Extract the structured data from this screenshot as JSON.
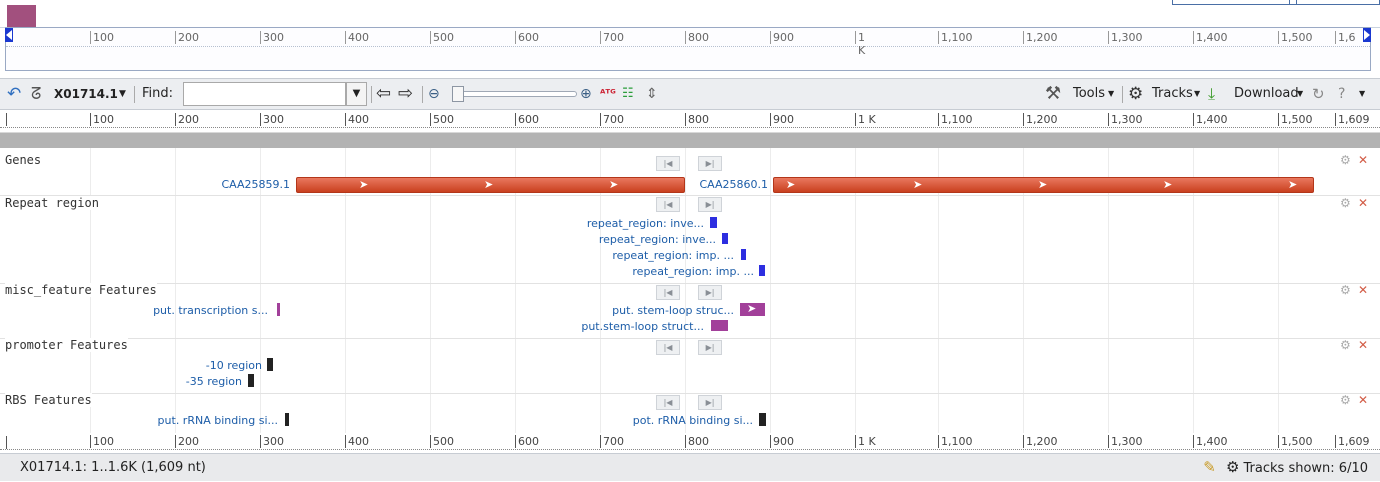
{
  "toolbar": {
    "sequence": "X01714.1",
    "find_label": "Find:",
    "find_value": "",
    "tools": "Tools",
    "tracks": "Tracks",
    "download": "Download"
  },
  "ruler_ticks": [
    "100",
    "200",
    "300",
    "400",
    "500",
    "600",
    "700",
    "800",
    "900",
    "1 K",
    "1,100",
    "1,200",
    "1,300",
    "1,400",
    "1,500",
    "1,609"
  ],
  "overview_ticks": [
    "100",
    "200",
    "300",
    "400",
    "500",
    "600",
    "700",
    "800",
    "900",
    "1 K",
    "1,100",
    "1,200",
    "1,300",
    "1,400",
    "1,500",
    "1,6"
  ],
  "tracks": [
    {
      "label": "Genes",
      "features": [
        "CAA25859.1",
        "CAA25860.1"
      ]
    },
    {
      "label": "Repeat region",
      "features": [
        "repeat_region: inve...",
        "repeat_region: inve...",
        "repeat_region: imp. ...",
        "repeat_region: imp. ..."
      ]
    },
    {
      "label": "misc_feature Features",
      "features": [
        "put. transcription s...",
        "put. stem-loop struc...",
        "put.stem-loop struct..."
      ]
    },
    {
      "label": "promoter Features",
      "features": [
        "-10 region",
        "-35 region"
      ]
    },
    {
      "label": "RBS Features",
      "features": [
        "put. rRNA binding si...",
        "pot. rRNA binding si..."
      ]
    }
  ],
  "colors": {
    "gene": "#d9533a",
    "repeat": "#2d2ee0",
    "misc": "#a2409a",
    "promoter": "#222222",
    "rbs": "#222222",
    "overview_swatch": "#a2507e"
  },
  "status": {
    "location": "X01714.1: 1..1.6K (1,609 nt)",
    "tracks_shown": "Tracks shown: 6/10"
  }
}
